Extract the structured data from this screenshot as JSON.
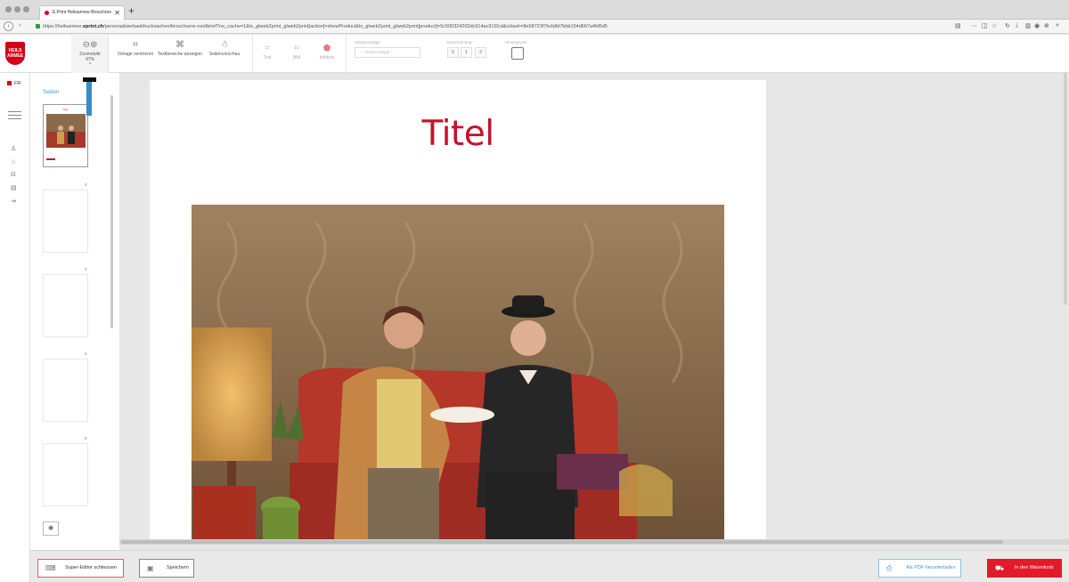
{
  "browser": {
    "tab_title": "E-Print Heilsarmee:Broschüre",
    "url_prefix": "https://heilsarmee.",
    "url_domain": "eprint.ch",
    "url_rest": "/personalisierbaeldrucksachen/broschuere-rundbrief?no_cache=1&tx_glweb2print_glweb2print[action]=showProduct&tx_glweb2print_glweb2print[product]=5c500324202dc914ac91f2cd&cHash=8e58723f7bcb8d7bbb154d667a4fd5d5"
  },
  "brand": {
    "logo_text": "HEILS ARMEE",
    "accent": "#d4001a"
  },
  "toolbar": {
    "zoom_label": "Zoomstufe",
    "zoom_value": "47%",
    "center_label": "Vorlage zentrieren",
    "text_areas_label": "Textbereiche anzeigen",
    "preview_label": "Seitenvorschau",
    "text_label": "Text",
    "image_label": "Bild",
    "infobox_label": "Infobox",
    "paragraph_group": "Absatzvorlage",
    "paragraph_placeholder": "-- Absatzvorlage --",
    "indent_group": "Auszeichnung",
    "indent_values": [
      "0",
      "1",
      "2"
    ],
    "background_group": "Hintergrund"
  },
  "rail": {
    "language": "FR"
  },
  "pages_panel": {
    "title": "Seiten",
    "page_numbers": [
      "2",
      "3",
      "4",
      "5"
    ]
  },
  "document": {
    "title": "Titel",
    "title_color": "#c8112c",
    "thumb_title": "Titel"
  },
  "footer": {
    "close_editor": "Super-Editor schliessen",
    "save": "Speichern",
    "pdf_download": "Als PDF herunterladen",
    "add_to_cart": "In den Warenkorb",
    "cart_color": "#e31a2b"
  }
}
